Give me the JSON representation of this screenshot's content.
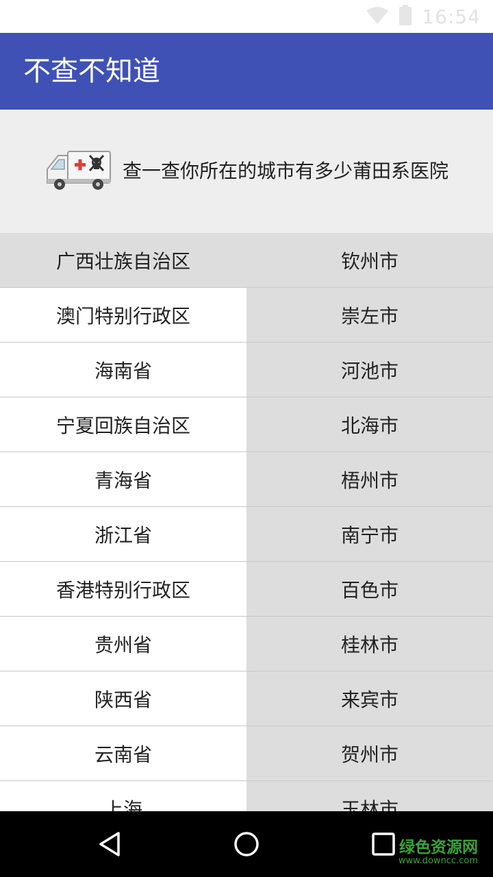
{
  "status_bar": {
    "time": "16:54",
    "icons": [
      "wifi-icon",
      "battery-icon"
    ]
  },
  "app_bar": {
    "title": "不查不知道",
    "color": "#3f51b5"
  },
  "banner": {
    "icon": "ambulance-skull-icon",
    "text": "查一查你所在的城市有多少莆田系医院"
  },
  "list": {
    "rows": [
      {
        "province": "广西壮族自治区",
        "city": "钦州市"
      },
      {
        "province": "澳门特别行政区",
        "city": "崇左市"
      },
      {
        "province": "海南省",
        "city": "河池市"
      },
      {
        "province": "宁夏回族自治区",
        "city": "北海市"
      },
      {
        "province": "青海省",
        "city": "梧州市"
      },
      {
        "province": "浙江省",
        "city": "南宁市"
      },
      {
        "province": "香港特别行政区",
        "city": "百色市"
      },
      {
        "province": "贵州省",
        "city": "桂林市"
      },
      {
        "province": "陕西省",
        "city": "来宾市"
      },
      {
        "province": "云南省",
        "city": "贺州市"
      },
      {
        "province": "上海",
        "city": "玉林市"
      }
    ]
  },
  "nav_bar": {
    "buttons": [
      "back-icon",
      "home-icon",
      "recents-icon"
    ]
  },
  "watermark": {
    "name": "绿色资源网",
    "url": "www.downcc.com"
  }
}
